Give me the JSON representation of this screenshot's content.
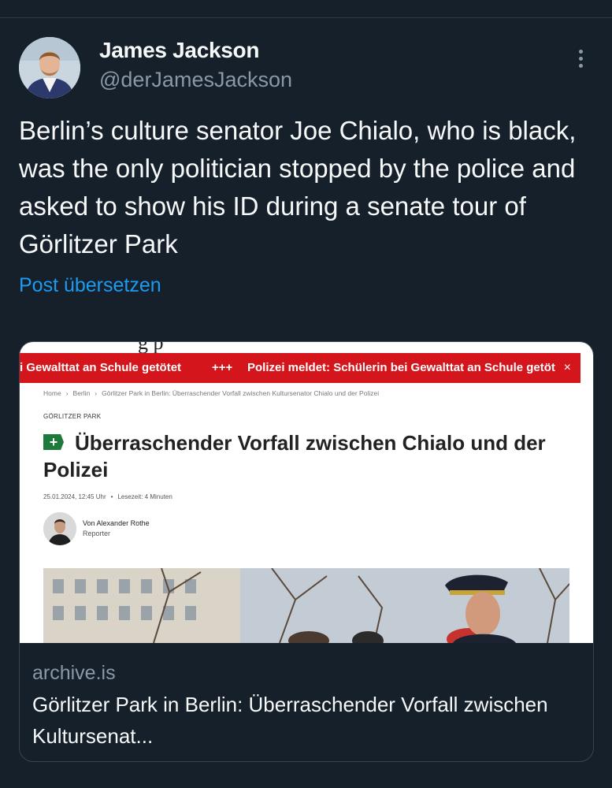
{
  "author": {
    "name": "James Jackson",
    "handle": "@derJamesJackson"
  },
  "tweet": {
    "text": "Berlin’s culture senator Joe Chialo, who is black, was the only politician stopped by the police and asked to show his ID during a senate tour of Görlitzer Park",
    "translate_label": "Post übersetzen"
  },
  "card": {
    "domain": "archive.is",
    "title": "Görlitzer Park in Berlin: Überraschender Vorfall zwischen Kultursenat...",
    "screenshot": {
      "ticker_left": "i Gewalttat an Schule getötet",
      "ticker_sep": "+++",
      "ticker_right": "Polizei meldet: Schülerin bei Gewalttat an Schule getöt",
      "ticker_close": "×",
      "breadcrumb": [
        "Home",
        "Berlin",
        "Görlitzer Park in Berlin: Überraschender Vorfall zwischen Kultursenator Chialo und der Polizei"
      ],
      "kicker": "GÖRLITZER PARK",
      "headline": "Überraschender Vorfall zwischen Chialo und der Polizei",
      "date": "25.01.2024, 12:45 Uhr",
      "reading_time": "Lesezeit: 4 Minuten",
      "author_von": "Von",
      "author_name": "Alexander Rothe",
      "author_role": "Reporter"
    }
  },
  "icons": {
    "more": "more-vertical-icon",
    "plus_badge": "+"
  },
  "colors": {
    "background": "#15202b",
    "text": "#f7f9f9",
    "muted": "#8b98a5",
    "link": "#1d9bf0",
    "ticker_red": "#d4161c",
    "plus_green": "#1e7a3a"
  }
}
